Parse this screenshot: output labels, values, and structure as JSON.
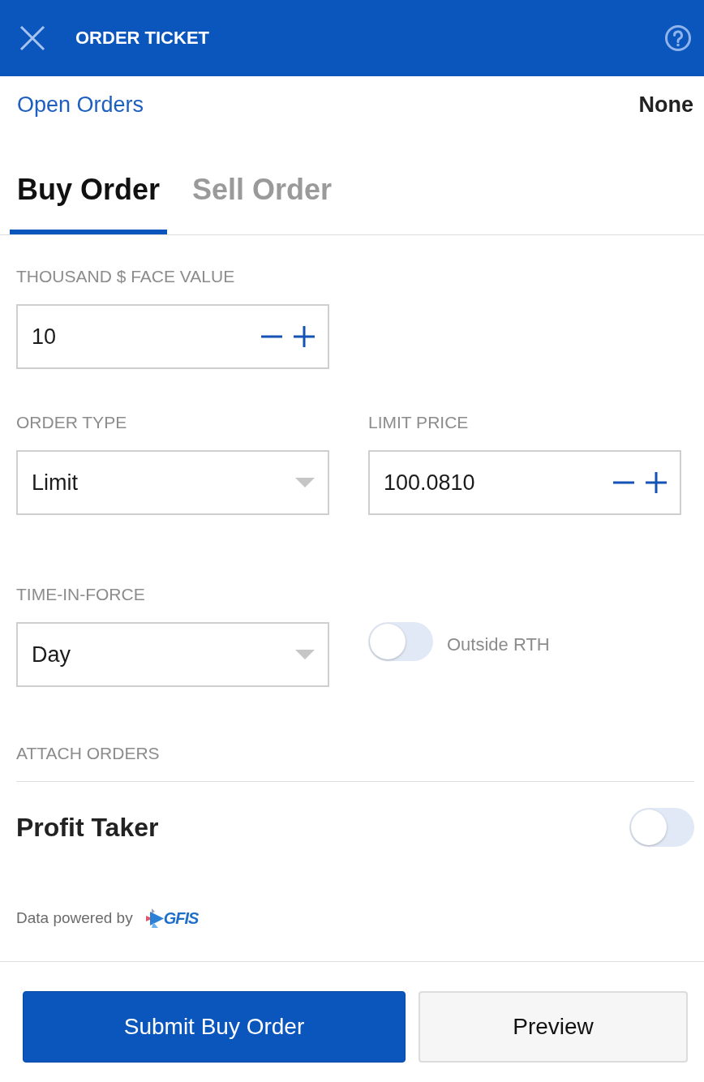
{
  "header": {
    "title": "ORDER TICKET"
  },
  "open_orders": {
    "label": "Open Orders",
    "value": "None"
  },
  "tabs": [
    {
      "label": "Buy Order",
      "selected": true
    },
    {
      "label": "Sell Order",
      "selected": false
    }
  ],
  "form": [
    {
      "cells": [
        {
          "kind": "stepper",
          "label": "THOUSAND $ FACE VALUE",
          "value": "10"
        }
      ]
    },
    {
      "cells": [
        {
          "kind": "dropdown",
          "label": "ORDER TYPE",
          "value": "Limit"
        },
        {
          "kind": "stepper",
          "label": "LIMIT PRICE",
          "value": "100.0810"
        }
      ]
    },
    {
      "cells": [
        {
          "kind": "dropdown",
          "label": "TIME-IN-FORCE",
          "value": "Day"
        },
        {
          "kind": "toggle",
          "label": "Outside RTH",
          "on": false
        }
      ]
    }
  ],
  "attach_orders": {
    "heading": "ATTACH ORDERS",
    "items": [
      {
        "label": "Profit Taker",
        "on": false
      }
    ]
  },
  "attribution": {
    "text": "Data powered by",
    "logo": "GFIS"
  },
  "buttons": [
    {
      "label": "Submit Buy Order",
      "kind": "primary"
    },
    {
      "label": "Preview",
      "kind": "secondary"
    }
  ]
}
